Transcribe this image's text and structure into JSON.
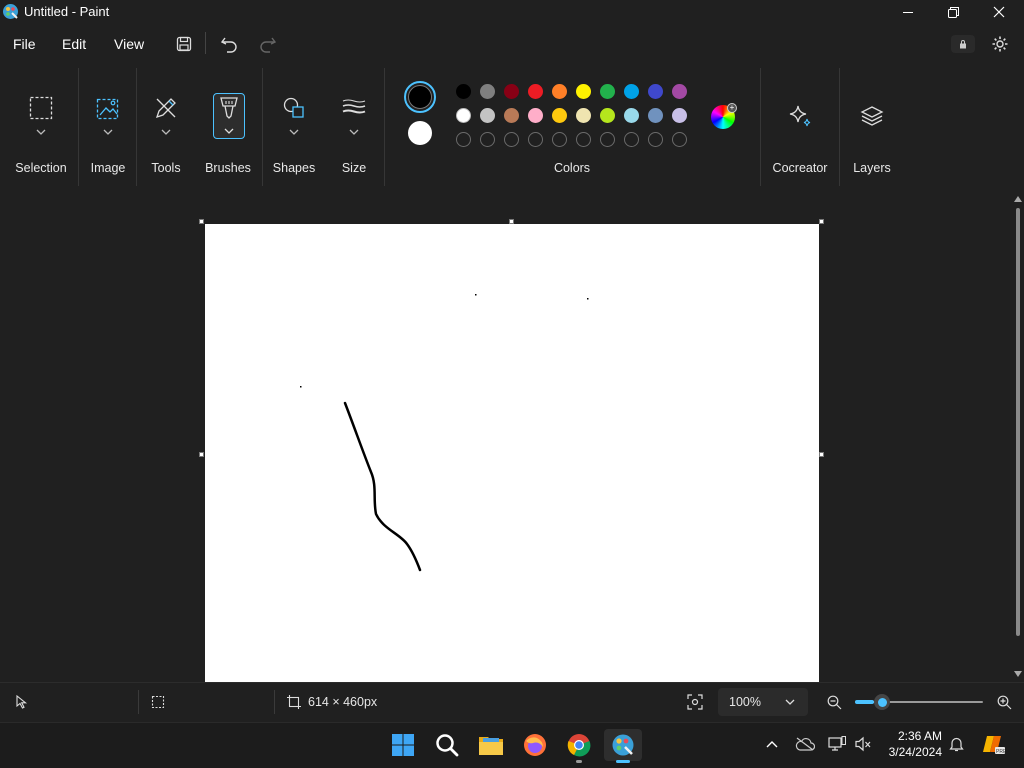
{
  "window": {
    "title": "Untitled - Paint"
  },
  "menu": {
    "file": "File",
    "edit": "Edit",
    "view": "View"
  },
  "ribbon": {
    "groups": {
      "selection": "Selection",
      "image": "Image",
      "tools": "Tools",
      "brushes": "Brushes",
      "shapes": "Shapes",
      "size": "Size",
      "colors": "Colors",
      "cocreator": "Cocreator",
      "layers": "Layers"
    },
    "active_colors": {
      "primary": "#000000",
      "secondary": "#ffffff"
    },
    "palette_row1": [
      "#000000",
      "#7f7f7f",
      "#880015",
      "#ed1c24",
      "#ff7f27",
      "#fff200",
      "#22b14c",
      "#00a2e8",
      "#3f48cc",
      "#a349a4"
    ],
    "palette_row2": [
      "#ffffff",
      "#c3c3c3",
      "#b97a57",
      "#ffaec9",
      "#ffc90e",
      "#efe4b0",
      "#b5e61d",
      "#99d9ea",
      "#7092be",
      "#c8bfe7"
    ],
    "palette_row3_empty_count": 10
  },
  "status": {
    "canvas_size": "614 × 460px",
    "zoom": "100%",
    "zoom_slider_fraction": 0.15
  },
  "taskbar": {
    "time": "2:36 AM",
    "date": "3/24/2024"
  },
  "colors": {
    "accent": "#4cc2ff",
    "background": "#202020"
  }
}
